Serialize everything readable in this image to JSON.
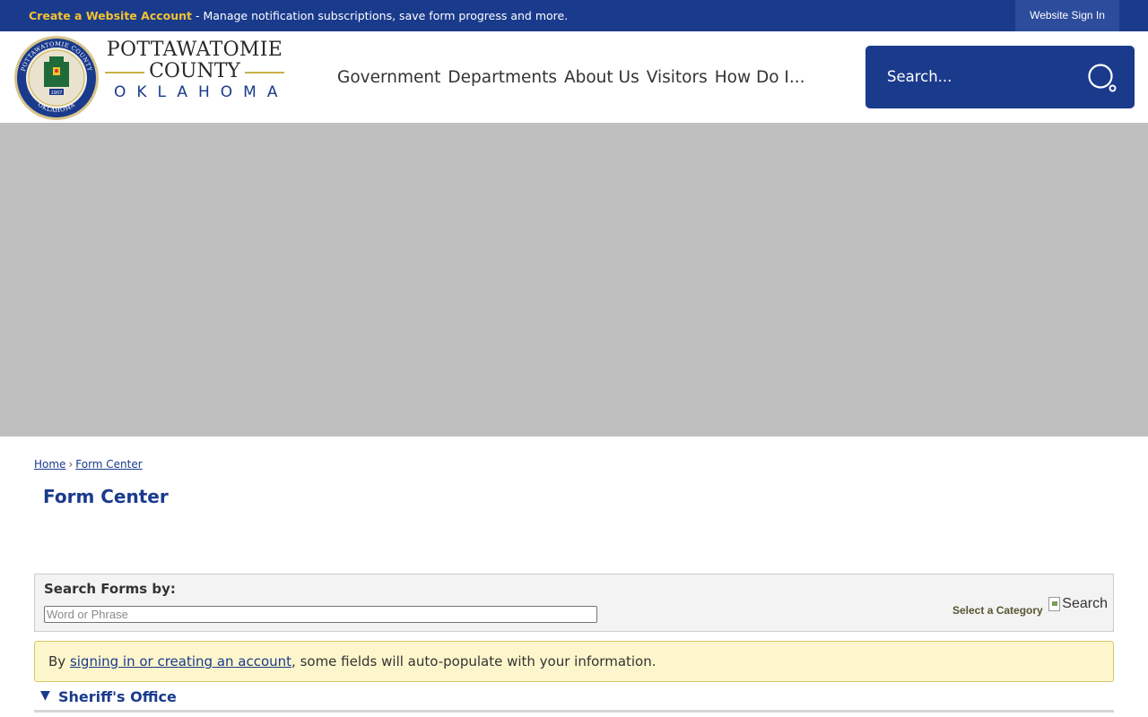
{
  "topbar": {
    "create_account_link": "Create a Website Account",
    "message": " - Manage notification subscriptions, save form progress and more.",
    "sign_in": "Website Sign In",
    "colors": {
      "background": "#1a3a8c",
      "accent": "#f2c230"
    }
  },
  "logo": {
    "seal_icon": "county-seal-icon",
    "line1": "POTTAWATOMIE",
    "line2": "COUNTY",
    "line3": "OKLAHOMA",
    "seal_text_top": "POTTAWATOMIE COUNTY",
    "seal_text_bottom": "OKLAHOMA",
    "seal_year": "1907"
  },
  "nav": {
    "items": [
      "Government",
      "Departments",
      "About Us",
      "Visitors",
      "How Do I..."
    ]
  },
  "search": {
    "placeholder": "Search...",
    "icon": "search-icon"
  },
  "breadcrumb": {
    "home": "Home",
    "separator": "›",
    "current": "Form Center"
  },
  "page": {
    "title": "Form Center"
  },
  "search_forms": {
    "label": "Search Forms by:",
    "placeholder": "Word or Phrase",
    "value": "",
    "category_label": "Select a Category",
    "search_button_alt": "Search"
  },
  "notice": {
    "prefix": "By ",
    "link": "signing in or creating an account",
    "suffix": ", some fields will auto-populate with your information."
  },
  "section": {
    "arrow": "▼",
    "title": "Sheriff's Office"
  }
}
